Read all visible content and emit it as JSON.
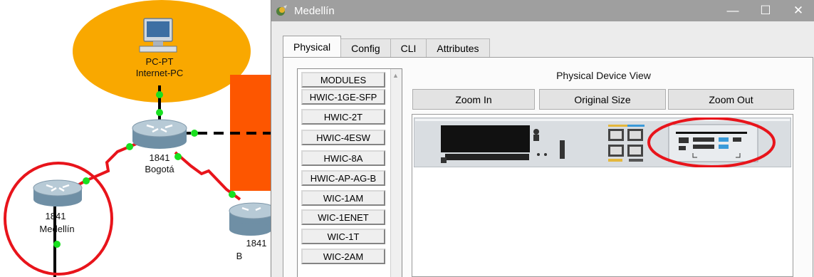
{
  "topology": {
    "pc": {
      "type_label": "PC-PT",
      "name_label": "Internet-PC",
      "icon": "desktop-pc-icon"
    },
    "routers": [
      {
        "model": "1841",
        "name": "Bogotá"
      },
      {
        "model": "1841",
        "name": "Medellín"
      },
      {
        "model": "1841",
        "name": "B"
      }
    ],
    "colors": {
      "cloud": "#f9a800",
      "block": "#fd5600",
      "serial_link": "#e8141b",
      "link_dot": "#19e01f",
      "annotation": "#e8141b"
    }
  },
  "window": {
    "title": "Medellín",
    "app_icon": "packet-tracer-icon",
    "controls": {
      "minimize": "—",
      "maximize": "☐",
      "close": "✕"
    },
    "tabs": [
      {
        "label": "Physical",
        "active": true
      },
      {
        "label": "Config",
        "active": false
      },
      {
        "label": "CLI",
        "active": false
      },
      {
        "label": "Attributes",
        "active": false
      }
    ]
  },
  "modules": {
    "items": [
      "MODULES",
      "HWIC-1GE-SFP",
      "HWIC-2T",
      "HWIC-4ESW",
      "HWIC-8A",
      "HWIC-AP-AG-B",
      "WIC-1AM",
      "WIC-1ENET",
      "WIC-1T",
      "WIC-2AM"
    ]
  },
  "device_view": {
    "title": "Physical Device View",
    "zoom_in": "Zoom In",
    "original_size": "Original Size",
    "zoom_out": "Zoom Out"
  }
}
